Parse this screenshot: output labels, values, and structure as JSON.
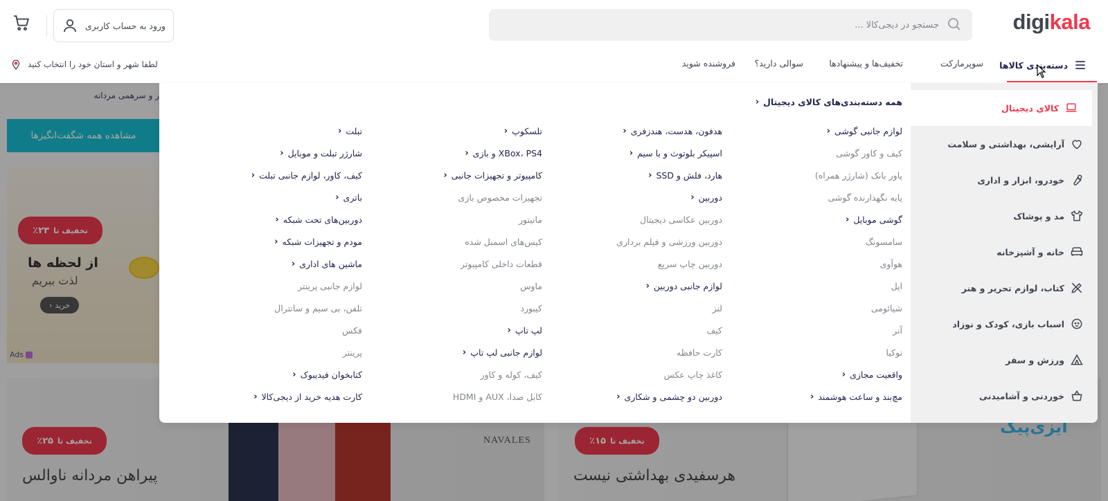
{
  "header": {
    "logo": {
      "part1": "digi",
      "part2": "kala"
    },
    "search": {
      "placeholder": "جستجو در دیجی‌کالا ..."
    },
    "login_label": "ورود به حساب کاربری"
  },
  "nav": {
    "categories_label": "دسته‌بندی کالاها",
    "items": [
      "سوپرمارکت",
      "تخفیف‌ها و پیشنهادها",
      "سوالی دارید؟",
      "فروشنده شوید"
    ],
    "location_label": "لطفا شهر و استان خود را انتخاب کنید"
  },
  "background": {
    "strip_text": "ر و سرهمی مردانه",
    "teal_button": "مشاهده همه شگفت‌انگیزها",
    "card1": {
      "badge_prefix": "تخفیف تا",
      "badge_value": "٪۲۳",
      "line1": "از لحظه ها",
      "line2": "لذت ببریم",
      "buy": "خرید",
      "ads": "Ads"
    },
    "card2": {
      "badge_prefix": "تخفیف تا",
      "badge_value": "٪۲۵",
      "title": "پیراهن مردانه ناوالس",
      "brand": "NAVALES"
    },
    "card3": {
      "badge_prefix": "تخفیف تا",
      "badge_value": "٪۱۵",
      "title": "هرسفیدی بهداشتی نیست",
      "brand": "ایزی‌پیک"
    }
  },
  "mega_menu": {
    "sidebar": [
      {
        "label": "کالای دیجیتال",
        "icon": "laptop-icon",
        "active": true
      },
      {
        "label": "آرایشی، بهداشتی و سلامت",
        "icon": "heart-icon"
      },
      {
        "label": "خودرو، ابزار و اداری",
        "icon": "wrench-icon"
      },
      {
        "label": "مد و پوشاک",
        "icon": "shirt-icon"
      },
      {
        "label": "خانه و آشپزخانه",
        "icon": "sofa-icon"
      },
      {
        "label": "کتاب، لوازم تحریر و هنر",
        "icon": "pencil-icon"
      },
      {
        "label": "اسباب بازی، کودک و نوزاد",
        "icon": "baby-icon"
      },
      {
        "label": "ورزش و سفر",
        "icon": "tent-icon"
      },
      {
        "label": "خوردنی و آشامیدنی",
        "icon": "basket-icon"
      }
    ],
    "all_categories_label": "همه دسته‌بندی‌های کالای دیجیتال",
    "columns": [
      [
        {
          "label": "لوازم جانبی گوشی",
          "head": true
        },
        {
          "label": "کیف و کاور گوشی"
        },
        {
          "label": "پاور بانک (شارژر همراه)"
        },
        {
          "label": "پایه نگهدارنده گوشی"
        },
        {
          "label": "گوشی موبایل",
          "head": true
        },
        {
          "label": "سامسونگ"
        },
        {
          "label": "هوآوی"
        },
        {
          "label": "اپل"
        },
        {
          "label": "شیائومی"
        },
        {
          "label": "آنر"
        },
        {
          "label": "نوکیا"
        },
        {
          "label": "واقعیت مجازی",
          "head": true
        },
        {
          "label": "مچ‌بند و ساعت هوشمند",
          "head": true
        }
      ],
      [
        {
          "label": "هدفون، هدست، هندزفری",
          "head": true
        },
        {
          "label": "اسپیکر بلوتوث و با سیم",
          "head": true
        },
        {
          "label": "هارد، فلش و SSD",
          "head": true
        },
        {
          "label": "دوربین",
          "head": true
        },
        {
          "label": "دوربین عکاسی دیجیتال"
        },
        {
          "label": "دوربین ورزشی و فیلم برداری"
        },
        {
          "label": "دوربین چاپ سریع"
        },
        {
          "label": "لوازم جانبی دوربین",
          "head": true
        },
        {
          "label": "لنز"
        },
        {
          "label": "کیف"
        },
        {
          "label": "کارت حافظه"
        },
        {
          "label": "کاغذ چاپ عکس"
        },
        {
          "label": "دوربین دو چشمی و شکاری",
          "head": true
        }
      ],
      [
        {
          "label": "تلسکوپ",
          "head": true
        },
        {
          "label": "XBox، PS4 و بازی",
          "head": true
        },
        {
          "label": "کامپیوتر و تجهیزات جانبی",
          "head": true
        },
        {
          "label": "تجهیزات مخصوص بازی"
        },
        {
          "label": "مانیتور"
        },
        {
          "label": "کیس‌های اسمبل شده"
        },
        {
          "label": "قطعات داخلی کامپیوتر"
        },
        {
          "label": "ماوس"
        },
        {
          "label": "کیبورد"
        },
        {
          "label": "لپ تاپ",
          "head": true
        },
        {
          "label": "لوازم جانبی لپ تاپ",
          "head": true
        },
        {
          "label": "کیف، کوله و کاور"
        },
        {
          "label": "کابل صدا، AUX و HDMI"
        }
      ],
      [
        {
          "label": "تبلت",
          "head": true
        },
        {
          "label": "شارژر تبلت و موبایل",
          "head": true
        },
        {
          "label": "کیف، کاور، لوازم جانبی تبلت",
          "head": true
        },
        {
          "label": "باتری",
          "head": true
        },
        {
          "label": "دوربین‌های تحت شبکه",
          "head": true
        },
        {
          "label": "مودم و تجهیزات شبکه",
          "head": true
        },
        {
          "label": "ماشین های اداری",
          "head": true
        },
        {
          "label": "لوازم جانبی پرینتر"
        },
        {
          "label": "تلفن، بی سیم و سانترال"
        },
        {
          "label": "فکس"
        },
        {
          "label": "پرینتر"
        },
        {
          "label": "کتابخوان فیدیبوک",
          "head": true
        },
        {
          "label": "کارت هدیه خرید از دیجی‌کالا",
          "head": true
        }
      ]
    ]
  },
  "colors": {
    "accent": "#ef394e",
    "teal": "#19bfd3",
    "text": "#23254e",
    "muted": "#81858b"
  }
}
